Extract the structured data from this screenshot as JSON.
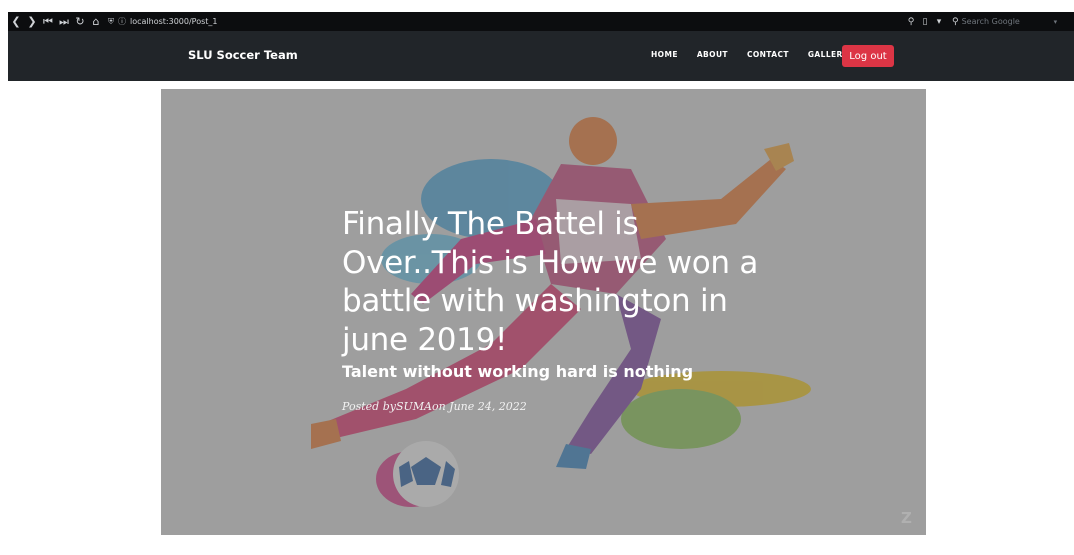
{
  "browser": {
    "url": "localhost:3000/Post_1",
    "search_placeholder": "Search Google"
  },
  "navbar": {
    "brand": "SLU Soccer Team",
    "items": [
      {
        "label": "HOME"
      },
      {
        "label": "ABOUT"
      },
      {
        "label": "CONTACT"
      },
      {
        "label": "GALLERY"
      }
    ],
    "logout_label": "Log out",
    "logout_color": "#dc3545",
    "bg_color": "#212529"
  },
  "post": {
    "title": "Finally The Battel is Over..This is How we won a battle with washington in june 2019!",
    "subtitle": "Talent without working hard is nothing",
    "meta": "Posted bySUMAon June 24, 2022"
  },
  "hero_image": {
    "subject": "soccer-player-kicking-ball-splash-art"
  }
}
